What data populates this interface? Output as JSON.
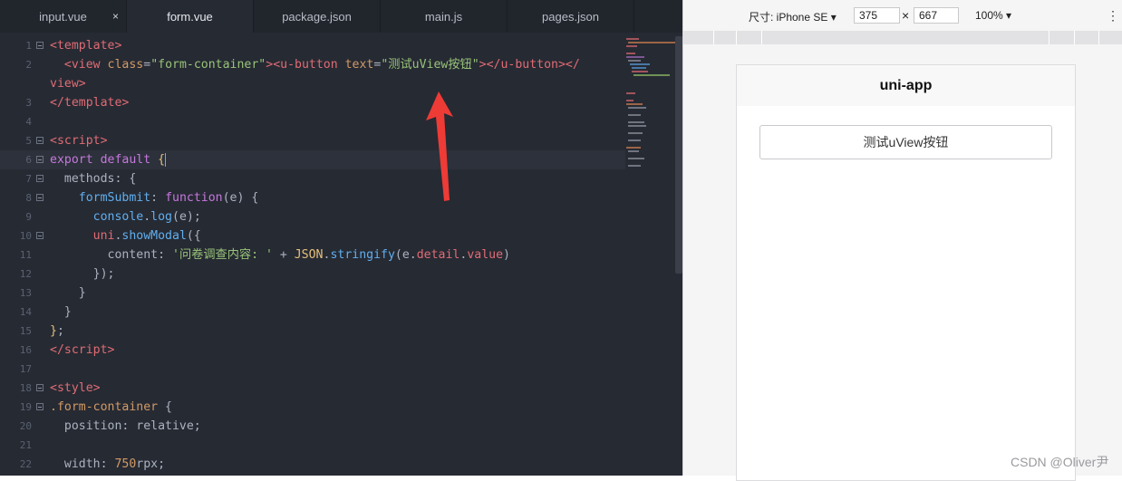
{
  "editor": {
    "tabs": [
      {
        "label": "input.vue",
        "close": "×"
      },
      {
        "label": "form.vue"
      },
      {
        "label": "package.json"
      },
      {
        "label": "main.js"
      },
      {
        "label": "pages.json"
      }
    ],
    "line_numbers": [
      "1",
      "2",
      "",
      "3",
      "4",
      "5",
      "6",
      "7",
      "8",
      "9",
      "10",
      "11",
      "12",
      "13",
      "14",
      "15",
      "16",
      "17",
      "18",
      "19",
      "20",
      "21",
      "22"
    ]
  },
  "simulator": {
    "size_label": "尺寸: iPhone SE ▾",
    "width_value": "375",
    "times": "×",
    "height_value": "667",
    "zoom_label": "100% ▾",
    "more_icon": "⋮",
    "nav_title": "uni-app",
    "button_text": "测试uView按钮"
  },
  "watermark": "CSDN @Oliver尹"
}
